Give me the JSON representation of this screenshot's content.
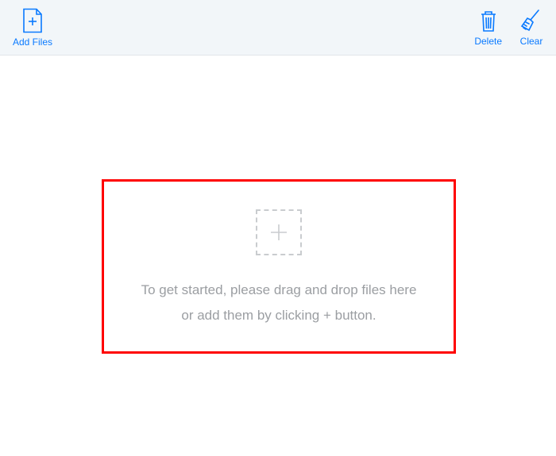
{
  "toolbar": {
    "add_files_label": "Add Files",
    "delete_label": "Delete",
    "clear_label": "Clear"
  },
  "dropzone": {
    "line1": "To get started, please drag and drop files here",
    "line2": "or add them by clicking + button."
  },
  "colors": {
    "accent": "#0a7aff",
    "highlight": "#ff0000",
    "muted": "#9b9ea2",
    "toolbar_bg": "#f2f6f9"
  }
}
